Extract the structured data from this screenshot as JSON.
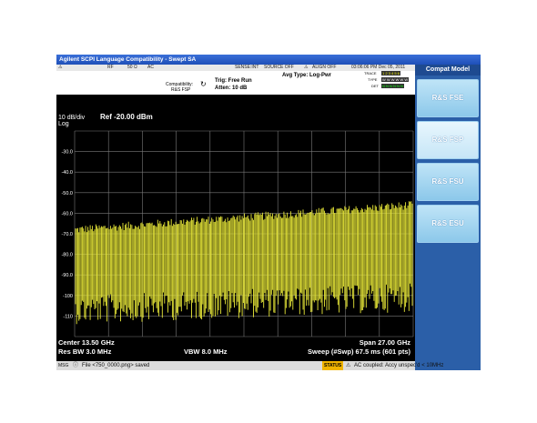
{
  "window": {
    "title": "Agilent SCPI Language Compatibility - Swept SA"
  },
  "status_row": {
    "rf": "RF",
    "impedance": "50 Ω",
    "coupling": "AC",
    "sense": "SENSE:INT",
    "source": "SOURCE OFF",
    "align": "ALIGN OFF",
    "datetime": "03:06:06 PM Dec 05, 2011"
  },
  "settings": {
    "avg_type": "Avg Type: Log-Pwr",
    "compat_label": "Compatibility:",
    "compat_value": "R&S FSP",
    "trig": "Trig: Free Run",
    "atten": "Atten: 10 dB",
    "trace_label": "TRACE",
    "type_label": "TYPE",
    "det_label": "DET",
    "trace_value": "1 2 3 4 5 6",
    "type_value": "W W W W W W",
    "det_value": "N N N N N N"
  },
  "display": {
    "scale": "10 dB/div",
    "scale_type": "Log",
    "ref": "Ref  -20.00 dBm",
    "center": "Center 13.50 GHz",
    "span": "Span 27.00 GHz",
    "res_bw": "Res BW 3.0 MHz",
    "vbw": "VBW 8.0 MHz",
    "sweep": "Sweep (#Swp)  67.5 ms (601 pts)",
    "y_ticks": [
      "-30.0",
      "-40.0",
      "-50.0",
      "-60.0",
      "-70.0",
      "-80.0",
      "-90.0",
      "-100",
      "-110"
    ],
    "trace_color": "#e8e838",
    "grid_color": "#7a7a7a"
  },
  "softkeys": {
    "title": "Compat Model",
    "items": [
      {
        "label": "R&S FSE",
        "selected": false
      },
      {
        "label": "R&S FSP",
        "selected": true
      },
      {
        "label": "R&S FSU",
        "selected": false
      },
      {
        "label": "R&S ESU",
        "selected": false
      }
    ]
  },
  "message_bar": {
    "msg_label": "MSG",
    "message": "File <750_0000.png> saved",
    "status_label": "STATUS",
    "status_message": "AC coupled: Accy unspec'd < 10MHz"
  }
}
